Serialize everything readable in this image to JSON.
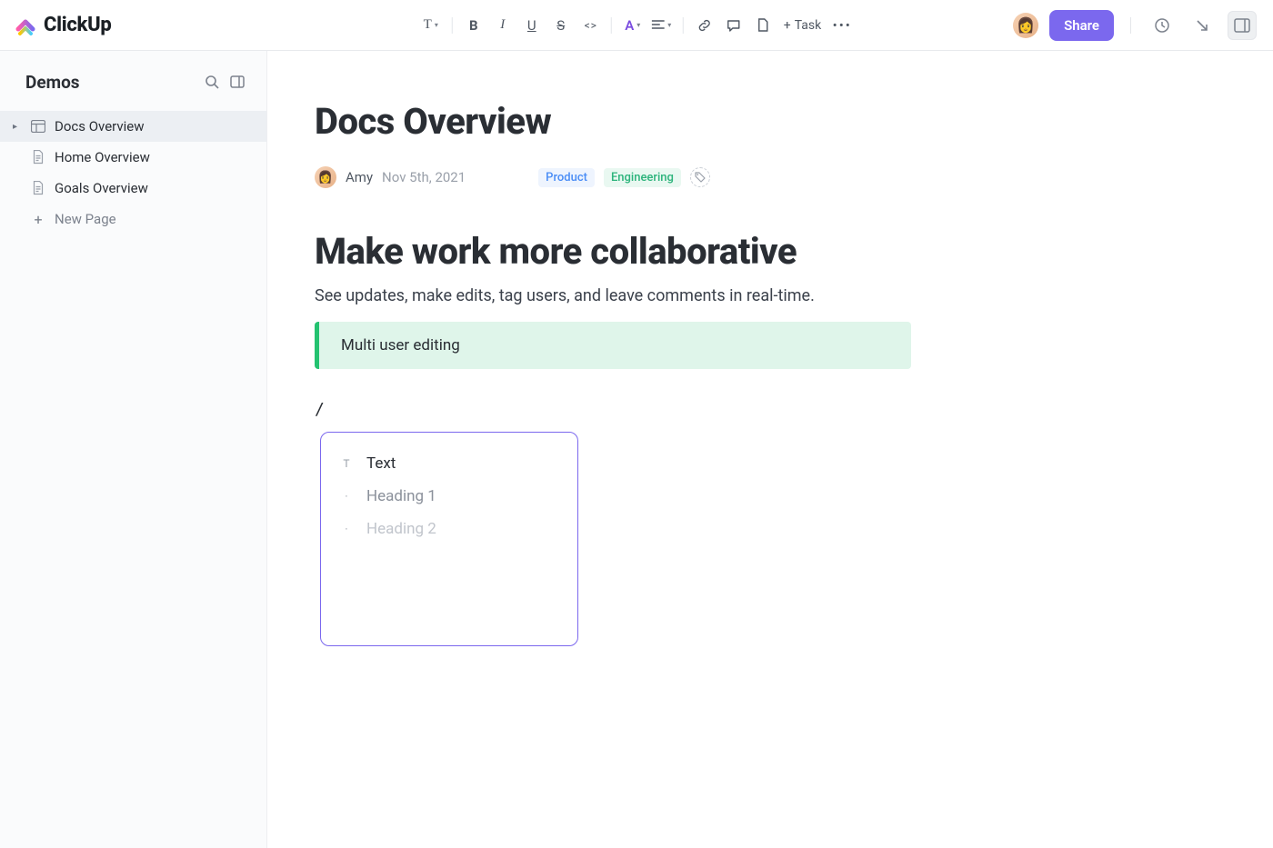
{
  "brand": {
    "name": "ClickUp"
  },
  "toolbar": {
    "text_style": "T",
    "bold": "B",
    "italic": "I",
    "underline": "U",
    "strike": "S",
    "code": "< >",
    "font_color": "A",
    "task_label": "Task"
  },
  "header_right": {
    "share_label": "Share"
  },
  "sidebar": {
    "title": "Demos",
    "items": [
      {
        "label": "Docs Overview",
        "active": true,
        "icon": "layout"
      },
      {
        "label": "Home Overview",
        "active": false,
        "icon": "doc"
      },
      {
        "label": "Goals Overview",
        "active": false,
        "icon": "doc"
      }
    ],
    "new_page_label": "New Page"
  },
  "doc": {
    "title": "Docs Overview",
    "author": "Amy",
    "date": "Nov 5th, 2021",
    "tags": [
      {
        "label": "Product",
        "kind": "product"
      },
      {
        "label": "Engineering",
        "kind": "engineering"
      }
    ],
    "h1": "Make work more collaborative",
    "paragraph": "See updates, make edits, tag users, and leave comments in real-time.",
    "callout": "Multi user editing",
    "slash_trigger": "/"
  },
  "slash_menu": {
    "items": [
      {
        "label": "Text",
        "state": "selected"
      },
      {
        "label": "Heading 1",
        "state": "fade1"
      },
      {
        "label": "Heading 2",
        "state": "fade2"
      }
    ]
  }
}
